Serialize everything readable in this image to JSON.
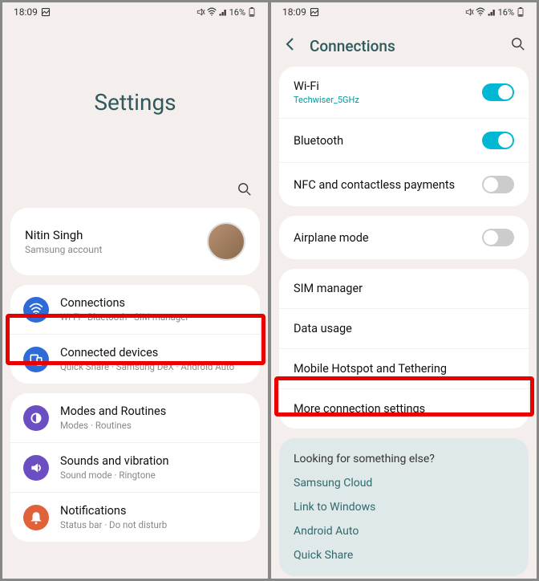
{
  "status": {
    "time": "18:09",
    "battery": "16%"
  },
  "left": {
    "title": "Settings",
    "profile": {
      "name": "Nitin Singh",
      "sub": "Samsung account"
    },
    "groups": [
      [
        {
          "icon": "wifi",
          "color": "#2f6bd6",
          "title": "Connections",
          "sub": "Wi-Fi · Bluetooth · SIM manager"
        },
        {
          "icon": "devices",
          "color": "#2f6bd6",
          "title": "Connected devices",
          "sub": "Quick Share · Samsung DeX · Android Auto"
        }
      ],
      [
        {
          "icon": "modes",
          "color": "#6b4fc2",
          "title": "Modes and Routines",
          "sub": "Modes · Routines"
        },
        {
          "icon": "sound",
          "color": "#6b4fc2",
          "title": "Sounds and vibration",
          "sub": "Sound mode · Ringtone"
        },
        {
          "icon": "notif",
          "color": "#e0623b",
          "title": "Notifications",
          "sub": "Status bar · Do not disturb"
        }
      ]
    ]
  },
  "right": {
    "title": "Connections",
    "groups": [
      [
        {
          "title": "Wi-Fi",
          "sub": "Techwiser_5GHz",
          "toggle": "on"
        },
        {
          "title": "Bluetooth",
          "toggle": "on"
        },
        {
          "title": "NFC and contactless payments",
          "toggle": "off"
        }
      ],
      [
        {
          "title": "Airplane mode",
          "toggle": "off"
        }
      ],
      [
        {
          "title": "SIM manager"
        },
        {
          "title": "Data usage"
        },
        {
          "title": "Mobile Hotspot and Tethering"
        },
        {
          "title": "More connection settings"
        }
      ]
    ],
    "looking": {
      "title": "Looking for something else?",
      "links": [
        "Samsung Cloud",
        "Link to Windows",
        "Android Auto",
        "Quick Share"
      ]
    }
  }
}
